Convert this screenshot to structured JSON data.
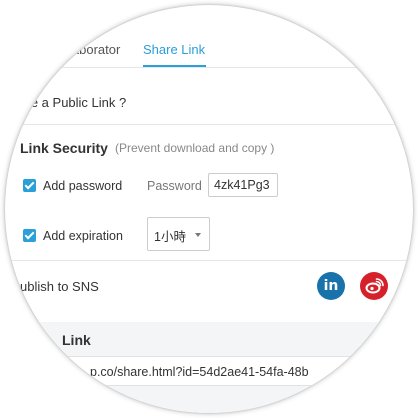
{
  "tabs": [
    {
      "label": "laborator"
    },
    {
      "label": "Share Link",
      "active": true
    }
  ],
  "public_link": {
    "question": "ate a Public Link ?"
  },
  "link_security": {
    "title": "Link Security",
    "note": "(Prevent download and copy )",
    "add_password": {
      "label": "Add password",
      "checked": true,
      "field_label": "Password",
      "value": "4zk41Pg3"
    },
    "add_expiration": {
      "label": "Add expiration",
      "checked": true,
      "selected": "1小時"
    }
  },
  "publish": {
    "label": "ublish to SNS",
    "icons": [
      "linkedin-icon",
      "weibo-icon"
    ],
    "linkedin_text": "in"
  },
  "link_section": {
    "title": "Link",
    "url": "p.co/share.html?id=54d2ae41-54fa-48b"
  },
  "colors": {
    "accent": "#2a9fd8",
    "linkedin": "#1a72ab",
    "weibo": "#d5222a"
  }
}
